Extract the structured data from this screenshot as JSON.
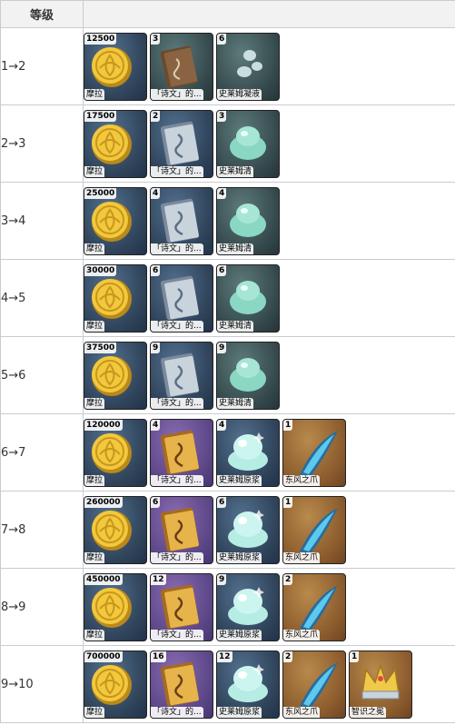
{
  "header": {
    "level_col": "等级"
  },
  "colors": {
    "blue": "#2e4258",
    "green": "#34484c",
    "purple": "#5a4686",
    "gold": "#8a5a2c"
  },
  "rows": [
    {
      "level": "1→2",
      "items": [
        {
          "icon": "mora-coin-icon",
          "bg": "blue",
          "qty": "12500",
          "name": "摩拉"
        },
        {
          "icon": "book-brown-icon",
          "bg": "green",
          "qty": "3",
          "name": "「诗文」的..."
        },
        {
          "icon": "slime-condensate-icon",
          "bg": "green",
          "qty": "6",
          "name": "史莱姆凝液"
        }
      ]
    },
    {
      "level": "2→3",
      "items": [
        {
          "icon": "mora-coin-icon",
          "bg": "blue",
          "qty": "17500",
          "name": "摩拉"
        },
        {
          "icon": "book-silver-icon",
          "bg": "blue",
          "qty": "2",
          "name": "「诗文」的..."
        },
        {
          "icon": "slime-secretions-icon",
          "bg": "green",
          "qty": "3",
          "name": "史莱姆清"
        }
      ]
    },
    {
      "level": "3→4",
      "items": [
        {
          "icon": "mora-coin-icon",
          "bg": "blue",
          "qty": "25000",
          "name": "摩拉"
        },
        {
          "icon": "book-silver-icon",
          "bg": "blue",
          "qty": "4",
          "name": "「诗文」的..."
        },
        {
          "icon": "slime-secretions-icon",
          "bg": "green",
          "qty": "4",
          "name": "史莱姆清"
        }
      ]
    },
    {
      "level": "4→5",
      "items": [
        {
          "icon": "mora-coin-icon",
          "bg": "blue",
          "qty": "30000",
          "name": "摩拉"
        },
        {
          "icon": "book-silver-icon",
          "bg": "blue",
          "qty": "6",
          "name": "「诗文」的..."
        },
        {
          "icon": "slime-secretions-icon",
          "bg": "green",
          "qty": "6",
          "name": "史莱姆清"
        }
      ]
    },
    {
      "level": "5→6",
      "items": [
        {
          "icon": "mora-coin-icon",
          "bg": "blue",
          "qty": "37500",
          "name": "摩拉"
        },
        {
          "icon": "book-silver-icon",
          "bg": "blue",
          "qty": "9",
          "name": "「诗文」的..."
        },
        {
          "icon": "slime-secretions-icon",
          "bg": "green",
          "qty": "9",
          "name": "史莱姆清"
        }
      ]
    },
    {
      "level": "6→7",
      "items": [
        {
          "icon": "mora-coin-icon",
          "bg": "blue",
          "qty": "120000",
          "name": "摩拉"
        },
        {
          "icon": "book-gold-icon",
          "bg": "purple",
          "qty": "4",
          "name": "「诗文」的..."
        },
        {
          "icon": "slime-concentrate-icon",
          "bg": "blue",
          "qty": "4",
          "name": "史莱姆原浆"
        },
        {
          "icon": "dvalin-claw-icon",
          "bg": "gold",
          "qty": "1",
          "name": "东风之爪"
        }
      ]
    },
    {
      "level": "7→8",
      "items": [
        {
          "icon": "mora-coin-icon",
          "bg": "blue",
          "qty": "260000",
          "name": "摩拉"
        },
        {
          "icon": "book-gold-icon",
          "bg": "purple",
          "qty": "6",
          "name": "「诗文」的..."
        },
        {
          "icon": "slime-concentrate-icon",
          "bg": "blue",
          "qty": "6",
          "name": "史莱姆原浆"
        },
        {
          "icon": "dvalin-claw-icon",
          "bg": "gold",
          "qty": "1",
          "name": "东风之爪"
        }
      ]
    },
    {
      "level": "8→9",
      "items": [
        {
          "icon": "mora-coin-icon",
          "bg": "blue",
          "qty": "450000",
          "name": "摩拉"
        },
        {
          "icon": "book-gold-icon",
          "bg": "purple",
          "qty": "12",
          "name": "「诗文」的..."
        },
        {
          "icon": "slime-concentrate-icon",
          "bg": "blue",
          "qty": "9",
          "name": "史莱姆原浆"
        },
        {
          "icon": "dvalin-claw-icon",
          "bg": "gold",
          "qty": "2",
          "name": "东风之爪"
        }
      ]
    },
    {
      "level": "9→10",
      "items": [
        {
          "icon": "mora-coin-icon",
          "bg": "blue",
          "qty": "700000",
          "name": "摩拉"
        },
        {
          "icon": "book-gold-icon",
          "bg": "purple",
          "qty": "16",
          "name": "「诗文」的..."
        },
        {
          "icon": "slime-concentrate-icon",
          "bg": "blue",
          "qty": "12",
          "name": "史莱姆原浆"
        },
        {
          "icon": "dvalin-claw-icon",
          "bg": "gold",
          "qty": "2",
          "name": "东风之爪"
        },
        {
          "icon": "crown-of-insight-icon",
          "bg": "gold",
          "qty": "1",
          "name": "智识之冕"
        }
      ]
    }
  ]
}
